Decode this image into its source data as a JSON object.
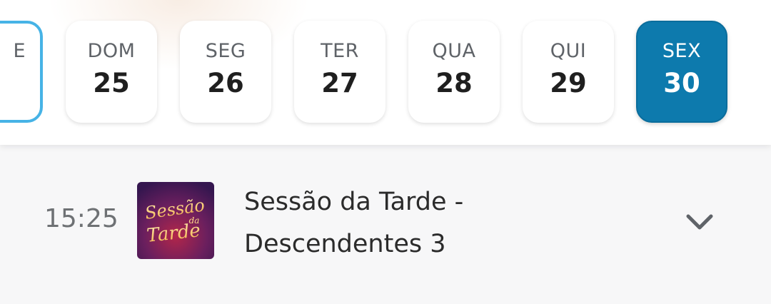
{
  "days": [
    {
      "dow": "E",
      "num": "",
      "state": "partial"
    },
    {
      "dow": "DOM",
      "num": "25",
      "state": "normal"
    },
    {
      "dow": "SEG",
      "num": "26",
      "state": "normal"
    },
    {
      "dow": "TER",
      "num": "27",
      "state": "normal"
    },
    {
      "dow": "QUA",
      "num": "28",
      "state": "normal"
    },
    {
      "dow": "QUI",
      "num": "29",
      "state": "normal"
    },
    {
      "dow": "SEX",
      "num": "30",
      "state": "selected"
    }
  ],
  "program": {
    "time": "15:25",
    "title_line1": "Sessão da Tarde -",
    "title_line2": "Descendentes 3",
    "thumbnail_logo_line1": "Sessão",
    "thumbnail_logo_line2": "da",
    "thumbnail_logo_line3": "Tarde",
    "expand_icon": "chevron-down-icon"
  },
  "colors": {
    "selected_day_bg": "#0d7aad",
    "partial_day_border": "#46b3e6",
    "thumbnail_bg": "#4a1b63"
  }
}
